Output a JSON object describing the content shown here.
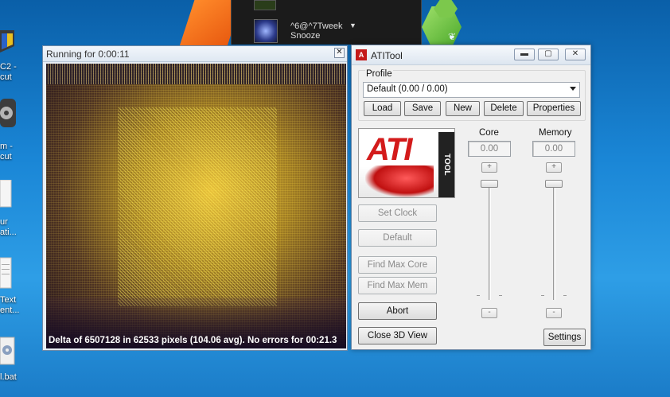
{
  "desktop": {
    "icons": [
      {
        "label1": "C2 -",
        "label2": "cut"
      },
      {
        "label1": "m -",
        "label2": "cut"
      },
      {
        "label1": "ur",
        "label2": "ati..."
      },
      {
        "label1": "Text",
        "label2": "ent..."
      },
      {
        "label1": "l.bat",
        "label2": ""
      }
    ]
  },
  "top_panel": {
    "item_line1": "^6@^7Tweek",
    "item_line2": "Snooze"
  },
  "render_window": {
    "title": "Running for 0:00:11",
    "close_glyph": "✕",
    "status": "Delta of 6507128 in 62533 pixels (104.06 avg). No errors for 00:21.3"
  },
  "ati_window": {
    "title": "ATITool",
    "minimize_glyph": "▬",
    "maximize_glyph": "▢",
    "close_glyph": "✕",
    "profile": {
      "label": "Profile",
      "selected": "Default (0.00 / 0.00)",
      "buttons": [
        "Load",
        "Save",
        "New",
        "Delete",
        "Properties"
      ]
    },
    "logo": {
      "text": "ATI",
      "side_text": "TOOL"
    },
    "core": {
      "label": "Core",
      "value": "0.00"
    },
    "memory": {
      "label": "Memory",
      "value": "0.00"
    },
    "spin_plus": "+",
    "spin_minus": "-",
    "actions": {
      "set_clock": "Set Clock",
      "default": "Default",
      "find_max_core": "Find Max Core",
      "find_max_mem": "Find Max Mem",
      "abort": "Abort",
      "close_3d_view": "Close 3D View",
      "settings": "Settings"
    }
  }
}
